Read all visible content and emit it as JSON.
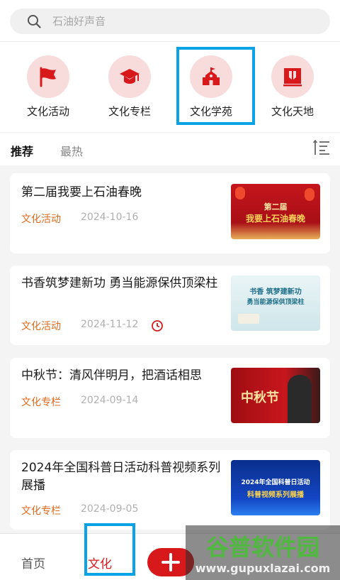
{
  "search": {
    "placeholder": "石油好声音"
  },
  "categories": [
    {
      "label": "文化活动",
      "icon": "flag-icon"
    },
    {
      "label": "文化专栏",
      "icon": "graduation-cap-icon"
    },
    {
      "label": "文化学苑",
      "icon": "school-building-icon"
    },
    {
      "label": "文化天地",
      "icon": "book-frame-icon"
    }
  ],
  "tabs": [
    {
      "label": "推荐"
    },
    {
      "label": "最热"
    }
  ],
  "articles": [
    {
      "title": "第二届我要上石油春晚",
      "tag": "文化活动",
      "date": "2024-10-16",
      "thumb_lines": [
        "第二届",
        "我要上石油春晚"
      ]
    },
    {
      "title": "书香筑梦建新功 勇当能源保供顶梁柱",
      "tag": "文化活动",
      "date": "2024-11-12",
      "thumb_lines": [
        "书香 筑梦建新功",
        "勇当能源保供顶梁柱"
      ]
    },
    {
      "title": "中秋节：清风伴明月，把酒话相思",
      "tag": "文化专栏",
      "date": "2024-09-14",
      "thumb_lines": [
        "中秋节"
      ]
    },
    {
      "title": "2024年全国科普日活动科普视频系列展播",
      "tag": "文化专栏",
      "date": "2024-09-05",
      "thumb_lines": [
        "2024年全国科普日活动",
        "科普视频系列展播"
      ]
    }
  ],
  "bottom_nav": [
    {
      "label": "首页"
    },
    {
      "label": "文化"
    }
  ],
  "watermark": {
    "cn": "谷普软件园",
    "en": "www.gupuxlazai.com"
  },
  "colors": {
    "accent": "#d7191c",
    "tag": "#e06a1c",
    "highlight": "#0aa3e6"
  }
}
